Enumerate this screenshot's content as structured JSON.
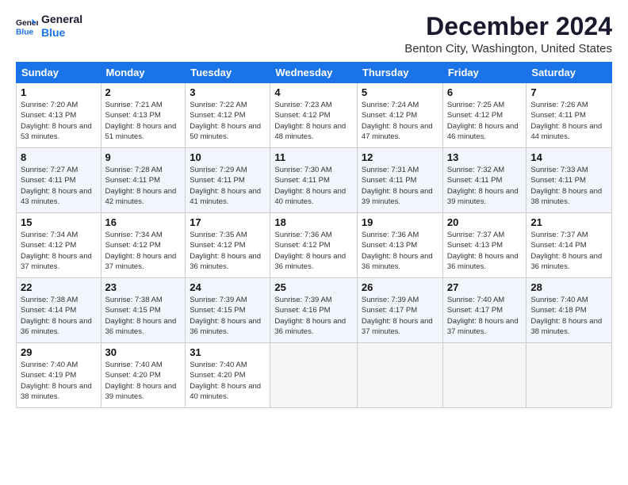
{
  "header": {
    "logo_line1": "General",
    "logo_line2": "Blue",
    "month_title": "December 2024",
    "location": "Benton City, Washington, United States"
  },
  "weekdays": [
    "Sunday",
    "Monday",
    "Tuesday",
    "Wednesday",
    "Thursday",
    "Friday",
    "Saturday"
  ],
  "weeks": [
    [
      {
        "day": "1",
        "sunrise": "7:20 AM",
        "sunset": "4:13 PM",
        "daylight": "8 hours and 53 minutes."
      },
      {
        "day": "2",
        "sunrise": "7:21 AM",
        "sunset": "4:13 PM",
        "daylight": "8 hours and 51 minutes."
      },
      {
        "day": "3",
        "sunrise": "7:22 AM",
        "sunset": "4:12 PM",
        "daylight": "8 hours and 50 minutes."
      },
      {
        "day": "4",
        "sunrise": "7:23 AM",
        "sunset": "4:12 PM",
        "daylight": "8 hours and 48 minutes."
      },
      {
        "day": "5",
        "sunrise": "7:24 AM",
        "sunset": "4:12 PM",
        "daylight": "8 hours and 47 minutes."
      },
      {
        "day": "6",
        "sunrise": "7:25 AM",
        "sunset": "4:12 PM",
        "daylight": "8 hours and 46 minutes."
      },
      {
        "day": "7",
        "sunrise": "7:26 AM",
        "sunset": "4:11 PM",
        "daylight": "8 hours and 44 minutes."
      }
    ],
    [
      {
        "day": "8",
        "sunrise": "7:27 AM",
        "sunset": "4:11 PM",
        "daylight": "8 hours and 43 minutes."
      },
      {
        "day": "9",
        "sunrise": "7:28 AM",
        "sunset": "4:11 PM",
        "daylight": "8 hours and 42 minutes."
      },
      {
        "day": "10",
        "sunrise": "7:29 AM",
        "sunset": "4:11 PM",
        "daylight": "8 hours and 41 minutes."
      },
      {
        "day": "11",
        "sunrise": "7:30 AM",
        "sunset": "4:11 PM",
        "daylight": "8 hours and 40 minutes."
      },
      {
        "day": "12",
        "sunrise": "7:31 AM",
        "sunset": "4:11 PM",
        "daylight": "8 hours and 39 minutes."
      },
      {
        "day": "13",
        "sunrise": "7:32 AM",
        "sunset": "4:11 PM",
        "daylight": "8 hours and 39 minutes."
      },
      {
        "day": "14",
        "sunrise": "7:33 AM",
        "sunset": "4:11 PM",
        "daylight": "8 hours and 38 minutes."
      }
    ],
    [
      {
        "day": "15",
        "sunrise": "7:34 AM",
        "sunset": "4:12 PM",
        "daylight": "8 hours and 37 minutes."
      },
      {
        "day": "16",
        "sunrise": "7:34 AM",
        "sunset": "4:12 PM",
        "daylight": "8 hours and 37 minutes."
      },
      {
        "day": "17",
        "sunrise": "7:35 AM",
        "sunset": "4:12 PM",
        "daylight": "8 hours and 36 minutes."
      },
      {
        "day": "18",
        "sunrise": "7:36 AM",
        "sunset": "4:12 PM",
        "daylight": "8 hours and 36 minutes."
      },
      {
        "day": "19",
        "sunrise": "7:36 AM",
        "sunset": "4:13 PM",
        "daylight": "8 hours and 36 minutes."
      },
      {
        "day": "20",
        "sunrise": "7:37 AM",
        "sunset": "4:13 PM",
        "daylight": "8 hours and 36 minutes."
      },
      {
        "day": "21",
        "sunrise": "7:37 AM",
        "sunset": "4:14 PM",
        "daylight": "8 hours and 36 minutes."
      }
    ],
    [
      {
        "day": "22",
        "sunrise": "7:38 AM",
        "sunset": "4:14 PM",
        "daylight": "8 hours and 36 minutes."
      },
      {
        "day": "23",
        "sunrise": "7:38 AM",
        "sunset": "4:15 PM",
        "daylight": "8 hours and 36 minutes."
      },
      {
        "day": "24",
        "sunrise": "7:39 AM",
        "sunset": "4:15 PM",
        "daylight": "8 hours and 36 minutes."
      },
      {
        "day": "25",
        "sunrise": "7:39 AM",
        "sunset": "4:16 PM",
        "daylight": "8 hours and 36 minutes."
      },
      {
        "day": "26",
        "sunrise": "7:39 AM",
        "sunset": "4:17 PM",
        "daylight": "8 hours and 37 minutes."
      },
      {
        "day": "27",
        "sunrise": "7:40 AM",
        "sunset": "4:17 PM",
        "daylight": "8 hours and 37 minutes."
      },
      {
        "day": "28",
        "sunrise": "7:40 AM",
        "sunset": "4:18 PM",
        "daylight": "8 hours and 38 minutes."
      }
    ],
    [
      {
        "day": "29",
        "sunrise": "7:40 AM",
        "sunset": "4:19 PM",
        "daylight": "8 hours and 38 minutes."
      },
      {
        "day": "30",
        "sunrise": "7:40 AM",
        "sunset": "4:20 PM",
        "daylight": "8 hours and 39 minutes."
      },
      {
        "day": "31",
        "sunrise": "7:40 AM",
        "sunset": "4:20 PM",
        "daylight": "8 hours and 40 minutes."
      },
      null,
      null,
      null,
      null
    ]
  ]
}
